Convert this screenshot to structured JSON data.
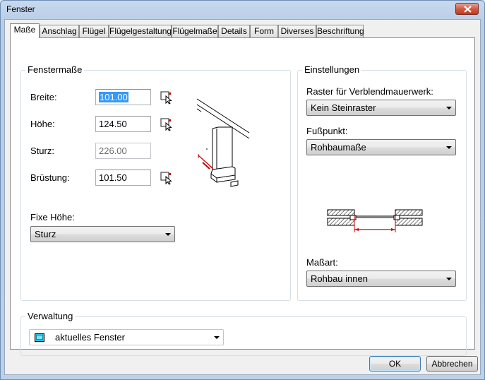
{
  "window": {
    "title": "Fenster"
  },
  "tabs": [
    {
      "label": "Maße"
    },
    {
      "label": "Anschlag"
    },
    {
      "label": "Flügel"
    },
    {
      "label": "Flügelgestaltung"
    },
    {
      "label": "Flügelmaße"
    },
    {
      "label": "Details"
    },
    {
      "label": "Form"
    },
    {
      "label": "Diverses"
    },
    {
      "label": "Beschriftung"
    }
  ],
  "fenstermasse": {
    "title": "Fenstermaße",
    "breite": {
      "label": "Breite:",
      "value": "101.00"
    },
    "hoehe": {
      "label": "Höhe:",
      "value": "124.50"
    },
    "sturz": {
      "label": "Sturz:",
      "value": "226.00"
    },
    "bruestung": {
      "label": "Brüstung:",
      "value": "101.50"
    },
    "fixe_hoehe": {
      "label": "Fixe Höhe:",
      "value": "Sturz"
    }
  },
  "einstellungen": {
    "title": "Einstellungen",
    "raster": {
      "label": "Raster für Verblendmauerwerk:",
      "value": "Kein Steinraster"
    },
    "fusspunkt": {
      "label": "Fußpunkt:",
      "value": "Rohbaumaße"
    },
    "massart": {
      "label": "Maßart:",
      "value": "Rohbau innen"
    }
  },
  "verwaltung": {
    "title": "Verwaltung",
    "value": "aktuelles Fenster"
  },
  "buttons": {
    "ok": "OK",
    "cancel": "Abbrechen"
  },
  "colors": {
    "accent_red": "#cc0000",
    "selection": "#3399ff",
    "icon_cyan": "#19c8e6"
  }
}
